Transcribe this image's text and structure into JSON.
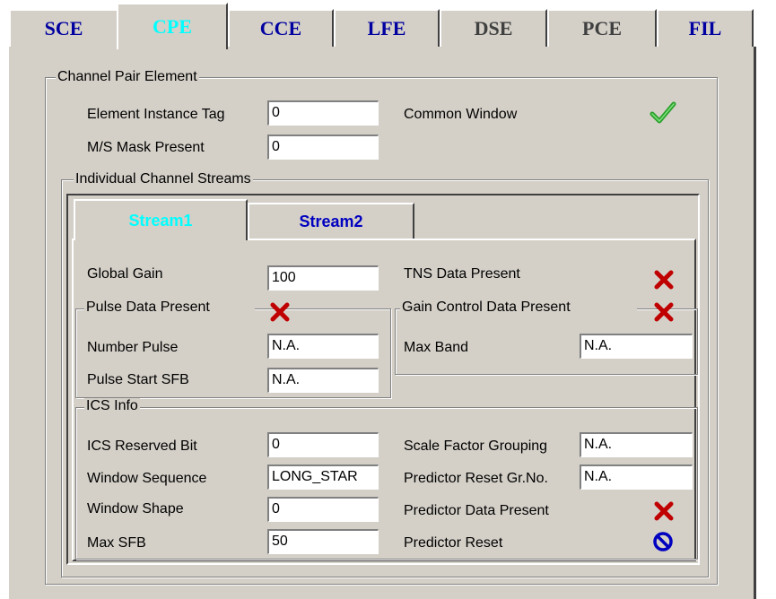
{
  "tabs": [
    {
      "label": "SCE",
      "state": "inactive"
    },
    {
      "label": "CPE",
      "state": "active"
    },
    {
      "label": "CCE",
      "state": "inactive"
    },
    {
      "label": "LFE",
      "state": "inactive"
    },
    {
      "label": "DSE",
      "state": "disabled"
    },
    {
      "label": "PCE",
      "state": "disabled"
    },
    {
      "label": "FIL",
      "state": "inactive"
    }
  ],
  "cpe": {
    "group_title": "Channel Pair Element",
    "element_instance_tag": {
      "label": "Element Instance Tag",
      "value": "0"
    },
    "ms_mask_present": {
      "label": "M/S Mask Present",
      "value": "0"
    },
    "common_window": {
      "label": "Common Window",
      "icon": "checkmark-icon",
      "color": "#2aa02a"
    }
  },
  "ics_streams": {
    "group_title": "Individual Channel Streams",
    "tabs": [
      {
        "label": "Stream1",
        "state": "active"
      },
      {
        "label": "Stream2",
        "state": "inactive"
      }
    ],
    "global_gain": {
      "label": "Global Gain",
      "value": "100"
    },
    "tns_data_present": {
      "label": "TNS Data Present",
      "icon": "cross-icon"
    },
    "pulse_data": {
      "group_title": "Pulse Data Present",
      "icon": "cross-icon",
      "number_pulse": {
        "label": "Number Pulse",
        "value": "N.A."
      },
      "pulse_start_sfb": {
        "label": "Pulse Start SFB",
        "value": "N.A."
      }
    },
    "gain_control": {
      "group_title": "Gain Control Data Present",
      "icon": "cross-icon",
      "max_band": {
        "label": "Max Band",
        "value": "N.A."
      }
    },
    "ics_info": {
      "group_title": "ICS Info",
      "ics_reserved_bit": {
        "label": "ICS Reserved Bit",
        "value": "0"
      },
      "window_sequence": {
        "label": "Window Sequence",
        "value": "LONG_STAR"
      },
      "window_shape": {
        "label": "Window Shape",
        "value": "0"
      },
      "max_sfb": {
        "label": "Max SFB",
        "value": "50"
      },
      "scale_factor_grouping": {
        "label": "Scale Factor Grouping",
        "value": "N.A."
      },
      "predictor_reset_gr_no": {
        "label": "Predictor Reset Gr.No.",
        "value": "N.A."
      },
      "predictor_data_present": {
        "label": "Predictor Data Present",
        "icon": "cross-icon"
      },
      "predictor_reset": {
        "label": "Predictor Reset",
        "icon": "no-entry-icon"
      }
    }
  },
  "colors": {
    "panel": "#d4d0c8",
    "tab_text": "#0000a0",
    "active_tab_text": "#00ffff",
    "cross": "#c00000",
    "no_entry": "#0000c0"
  }
}
